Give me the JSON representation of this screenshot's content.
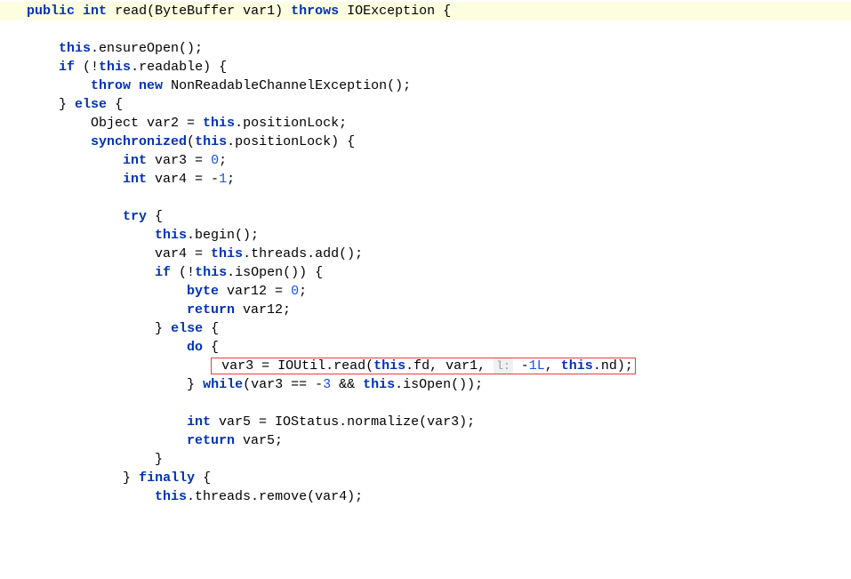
{
  "chart_data": {
    "type": "code",
    "language": "java",
    "title": "read method source"
  },
  "code": {
    "sig_public": "public",
    "sig_int": "int",
    "sig_read": "read(ByteBuffer var1)",
    "sig_throws": "throws",
    "sig_io": "IOException {",
    "l2_this": "this",
    "l2_rest": ".ensureOpen();",
    "l3_if": "if",
    "l3_cond_open": " (!",
    "l3_this": "this",
    "l3_cond_close": ".readable) {",
    "l4_throw": "throw",
    "l4_new": "new",
    "l4_rest": " NonReadableChannelException();",
    "l5_close": "}",
    "l5_else": "else",
    "l5_open": "{",
    "l6_pre": "Object var2 = ",
    "l6_this": "this",
    "l6_rest": ".positionLock;",
    "l7_sync": "synchronized",
    "l7_open": "(",
    "l7_this": "this",
    "l7_rest": ".positionLock) {",
    "l8_int": "int",
    "l8_var": " var3 = ",
    "l8_val": "0",
    "l8_semi": ";",
    "l9_int": "int",
    "l9_var": " var4 = -",
    "l9_val": "1",
    "l9_semi": ";",
    "l10_try": "try",
    "l10_brace": " {",
    "l11_this": "this",
    "l11_rest": ".begin();",
    "l12_pre": "var4 = ",
    "l12_this": "this",
    "l12_rest": ".threads.add();",
    "l13_if": "if",
    "l13_pre": " (!",
    "l13_this": "this",
    "l13_rest": ".isOpen()) {",
    "l14_byte": "byte",
    "l14_mid": " var12 = ",
    "l14_val": "0",
    "l14_semi": ";",
    "l15_return": "return",
    "l15_rest": " var12;",
    "l16_close": "}",
    "l16_else": "else",
    "l16_open": "{",
    "l17_do": "do",
    "l17_brace": " {",
    "l18_pre": "var3 = IOUtil.read(",
    "l18_this1": "this",
    "l18_mid1": ".fd, var1, ",
    "l18_hint": "l:",
    "l18_mid2": " -",
    "l18_val": "1L",
    "l18_mid3": ", ",
    "l18_this2": "this",
    "l18_end": ".nd);",
    "l19_close": "}",
    "l19_while": "while",
    "l19_cond_pre": "(var3 == -",
    "l19_val": "3",
    "l19_mid": " && ",
    "l19_this": "this",
    "l19_rest": ".isOpen());",
    "l20_int": "int",
    "l20_rest": " var5 = IOStatus.normalize(var3);",
    "l21_return": "return",
    "l21_rest": " var5;",
    "l22_close": "}",
    "l23_close": "}",
    "l23_finally": "finally",
    "l23_open": "{",
    "l24_this": "this",
    "l24_rest": ".threads.remove(var4);"
  }
}
